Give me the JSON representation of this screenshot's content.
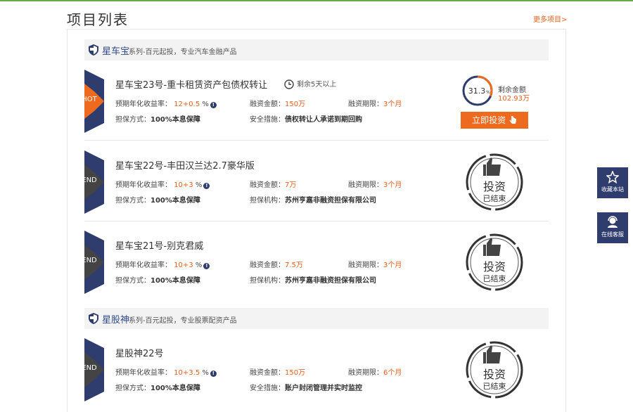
{
  "page": {
    "title": "项目列表",
    "more": "更多项目>"
  },
  "series": [
    {
      "name": "星车宝",
      "desc": "系列-百元起投，专业汽车金融产品"
    },
    {
      "name": "星股神",
      "desc": "系列-百元起投，专业股票配资产品"
    }
  ],
  "labels": {
    "rate": "预期年化收益率：",
    "amount": "融资金额：",
    "term": "融资期限：",
    "guarantee": "担保方式：",
    "security": "安全措施：",
    "agency": "担保机构：",
    "guarantee_value": "100%本息保障",
    "remain_label": "剩余金额",
    "invest_button": "立即投资",
    "info": "!",
    "stamp_top": "投资",
    "stamp_bottom": "已结束"
  },
  "items": [
    {
      "ribbon": "HOT",
      "title": "星车宝23号-重卡租赁资产包债权转让",
      "timer": "剩余5天以上",
      "rate": "12+0.5",
      "rate_unit": "%",
      "amount": "150万",
      "term": "3个月",
      "extra_label": "安全措施：",
      "extra_value": "债权转让人承诺到期回购",
      "progress_text": "31.3",
      "progress_unit": "%",
      "progress": 0.313,
      "remain": "102.93万"
    },
    {
      "ribbon": "END",
      "title": "星车宝22号-丰田汉兰达2.7豪华版",
      "rate": "10+3",
      "rate_unit": "%",
      "amount": "7万",
      "term": "3个月",
      "extra_label": "担保机构：",
      "extra_value": "苏州亨嘉非融资担保有限公司"
    },
    {
      "ribbon": "END",
      "title": "星车宝21号-别克君威",
      "rate": "10+3",
      "rate_unit": "%",
      "amount": "7.5万",
      "term": "3个月",
      "extra_label": "担保机构：",
      "extra_value": "苏州亨嘉非融资担保有限公司"
    },
    {
      "ribbon": "END",
      "title": "星股神22号",
      "rate": "10+3.5",
      "rate_unit": "%",
      "amount": "150万",
      "term": "6个月",
      "extra_label": "安全措施：",
      "extra_value": "账户封闭管理并实时监控"
    }
  ],
  "side": {
    "favorite": "收藏本站",
    "service": "在线客服"
  },
  "colors": {
    "accent": "#ee6a1e",
    "navy": "#2f3d6e",
    "hot": "#ee6a1e",
    "end": "#444444"
  }
}
